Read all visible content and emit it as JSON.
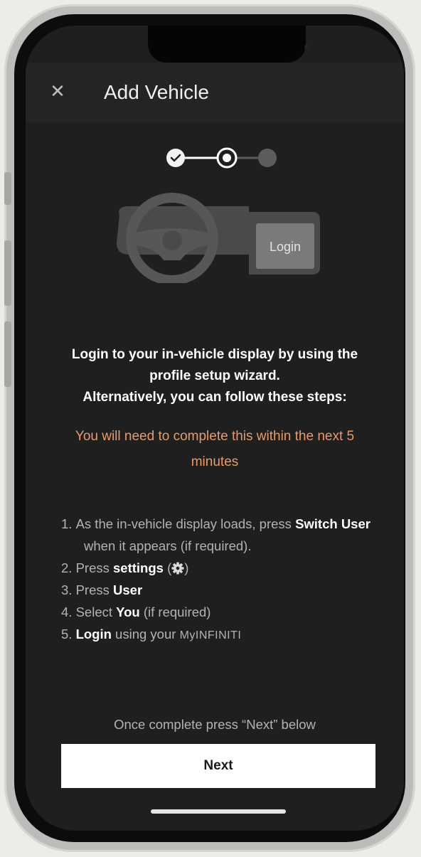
{
  "header": {
    "close_icon": "close-icon",
    "title": "Add Vehicle"
  },
  "stepper": {
    "total_steps": 3,
    "completed_steps": 1,
    "current_step": 2
  },
  "illustration": {
    "screen_label": "Login"
  },
  "intro": {
    "line1": "Login to your in-vehicle display by using the",
    "line2": "profile setup wizard.",
    "line3": "Alternatively, you can follow these steps:"
  },
  "warning": {
    "text": "You will need to complete this within the next 5 minutes"
  },
  "steps": [
    {
      "num": "1.",
      "pre": "As the in-vehicle display loads, press ",
      "bold": "Switch User",
      "post": " when it appears (if required)."
    },
    {
      "num": "2.",
      "pre": "Press ",
      "bold": "settings",
      "post_open": " (",
      "icon": "gear-icon",
      "post_close": ")"
    },
    {
      "num": "3.",
      "pre": "Press ",
      "bold": "User",
      "post": ""
    },
    {
      "num": "4.",
      "pre": "Select ",
      "bold": "You",
      "post": " (if required)"
    },
    {
      "num": "5.",
      "pre": "",
      "bold": "Login",
      "post": " using your ",
      "brand": "MyINFINITI"
    }
  ],
  "footer": {
    "note": "Once complete press “Next” below",
    "next_label": "Next"
  },
  "colors": {
    "background": "#1f1f1f",
    "header": "#242424",
    "accent_warning": "#e89a6a",
    "button": "#ffffff"
  }
}
